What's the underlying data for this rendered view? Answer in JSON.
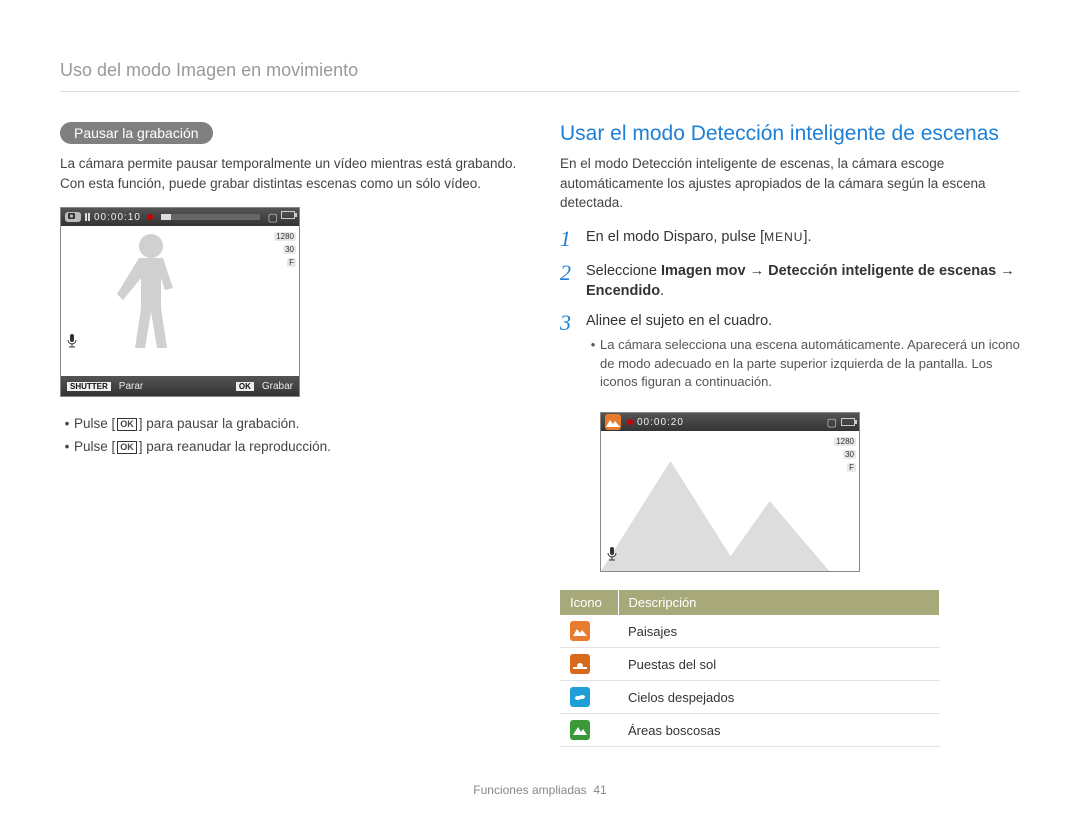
{
  "header": {
    "breadcrumb": "Uso del modo Imagen en movimiento"
  },
  "left": {
    "pill": "Pausar la grabación",
    "intro": "La cámara permite pausar temporalmente un vídeo mientras está grabando. Con esta función, puede grabar distintas escenas como un sólo vídeo.",
    "lcd": {
      "time": "00:00:10",
      "res": "1280",
      "fps": "30",
      "flash": "F",
      "shutter_label": "SHUTTER",
      "parar": "Parar",
      "ok_label": "OK",
      "grabar": "Grabar"
    },
    "bullets": [
      {
        "pre": "Pulse [",
        "ok": "OK",
        "post": "] para pausar la grabación."
      },
      {
        "pre": "Pulse [",
        "ok": "OK",
        "post": "] para reanudar la reproducción."
      }
    ]
  },
  "right": {
    "h2": "Usar el modo Detección inteligente de escenas",
    "intro": "En el modo Detección inteligente de escenas, la cámara escoge automáticamente los ajustes apropiados de la cámara según la escena detectada.",
    "steps": [
      {
        "num": "1",
        "body_pre": "En el modo Disparo, pulse [",
        "menu": "MENU",
        "body_post": "]."
      },
      {
        "num": "2",
        "body_plain_pre": "Seleccione ",
        "bold_1": "Imagen mov",
        "arrow1": "→",
        "bold_2": "Detección inteligente de escenas",
        "arrow2": "→",
        "bold_3": "Encendido",
        "body_plain_post": "."
      },
      {
        "num": "3",
        "body_plain": "Alinee el sujeto en el cuadro.",
        "subs": [
          "La cámara selecciona una escena automáticamente. Aparecerá un icono de modo adecuado en la parte superior izquierda de la pantalla. Los iconos figuran a continuación."
        ]
      }
    ],
    "lcd": {
      "time": "00:00:20",
      "res": "1280",
      "fps": "30",
      "flash": "F"
    },
    "table": {
      "h_icon": "Icono",
      "h_desc": "Descripción",
      "rows": [
        {
          "color": "ico-orange",
          "desc": "Paisajes"
        },
        {
          "color": "ico-orange-dk",
          "desc": "Puestas del sol"
        },
        {
          "color": "ico-blue",
          "desc": "Cielos despejados"
        },
        {
          "color": "ico-green",
          "desc": "Áreas boscosas"
        }
      ]
    }
  },
  "footer": {
    "section": "Funciones ampliadas",
    "page": "41"
  }
}
